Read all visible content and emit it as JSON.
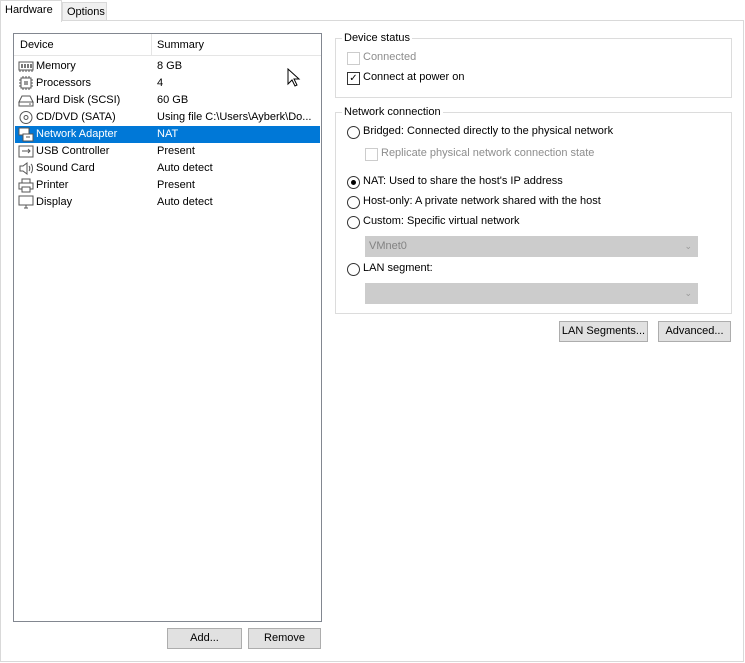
{
  "tabs": [
    {
      "label": "Hardware",
      "active": true
    },
    {
      "label": "Options",
      "active": false
    }
  ],
  "device_list": {
    "columns": [
      "Device",
      "Summary"
    ],
    "rows": [
      {
        "icon": "memory-icon",
        "device": "Memory",
        "summary": "8 GB",
        "selected": false
      },
      {
        "icon": "processor-icon",
        "device": "Processors",
        "summary": "4",
        "selected": false
      },
      {
        "icon": "hard-disk-icon",
        "device": "Hard Disk (SCSI)",
        "summary": "60 GB",
        "selected": false
      },
      {
        "icon": "cd-dvd-icon",
        "device": "CD/DVD (SATA)",
        "summary": "Using file C:\\Users\\Ayberk\\Do...",
        "selected": false
      },
      {
        "icon": "network-adapter-icon",
        "device": "Network Adapter",
        "summary": "NAT",
        "selected": true
      },
      {
        "icon": "usb-controller-icon",
        "device": "USB Controller",
        "summary": "Present",
        "selected": false
      },
      {
        "icon": "sound-card-icon",
        "device": "Sound Card",
        "summary": "Auto detect",
        "selected": false
      },
      {
        "icon": "printer-icon",
        "device": "Printer",
        "summary": "Present",
        "selected": false
      },
      {
        "icon": "display-icon",
        "device": "Display",
        "summary": "Auto detect",
        "selected": false
      }
    ]
  },
  "list_buttons": {
    "add": "Add...",
    "remove": "Remove"
  },
  "device_status": {
    "title": "Device status",
    "connected": {
      "label": "Connected",
      "checked": false,
      "enabled": false
    },
    "connect_at_power_on": {
      "label": "Connect at power on",
      "checked": true,
      "enabled": true
    }
  },
  "network_connection": {
    "title": "Network connection",
    "bridged": {
      "label": "Bridged: Connected directly to the physical network",
      "checked": false
    },
    "replicate": {
      "label": "Replicate physical network connection state",
      "checked": false,
      "enabled": false
    },
    "nat": {
      "label": "NAT: Used to share the host's IP address",
      "checked": true
    },
    "host_only": {
      "label": "Host-only: A private network shared with the host",
      "checked": false
    },
    "custom": {
      "label": "Custom: Specific virtual network",
      "checked": false
    },
    "custom_select": {
      "value": "VMnet0"
    },
    "lan_segment": {
      "label": "LAN segment:",
      "checked": false
    },
    "lan_select": {
      "value": ""
    }
  },
  "bottom_buttons": {
    "lan_segments": "LAN Segments...",
    "advanced": "Advanced..."
  },
  "colors": {
    "selection": "#0078d7",
    "tab_bg": "#f0f0f0",
    "disabled_text": "#8d8d8d"
  }
}
